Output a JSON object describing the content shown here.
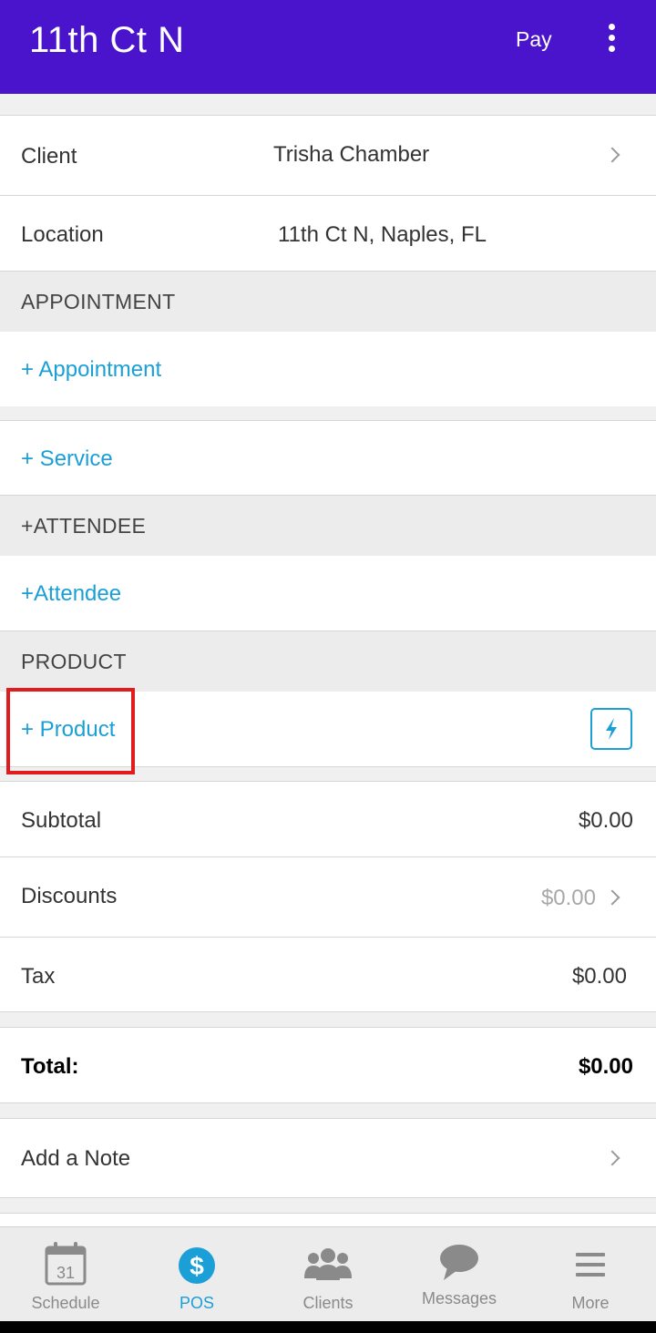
{
  "header": {
    "title": "11th Ct N",
    "pay_label": "Pay",
    "menu_icon": "more-vert-icon",
    "bg_color": "#4a14cc"
  },
  "client": {
    "label": "Client",
    "value": "Trisha Chamber"
  },
  "location": {
    "label": "Location",
    "value": "11th Ct N, Naples, FL"
  },
  "appointment": {
    "header": "APPOINTMENT",
    "add_label": "+ Appointment"
  },
  "service": {
    "add_label": "+ Service"
  },
  "attendee": {
    "header": "+ATTENDEE",
    "add_label": "+Attendee"
  },
  "product": {
    "header": "PRODUCT",
    "add_label": "+ Product",
    "quick_icon": "lightning-icon"
  },
  "totals": {
    "subtotal_label": "Subtotal",
    "subtotal_value": "$0.00",
    "discounts_label": "Discounts",
    "discounts_value": "$0.00",
    "tax_label": "Tax",
    "tax_value": "$0.00",
    "total_label": "Total:",
    "total_value": "$0.00"
  },
  "note": {
    "label": "Add a Note"
  },
  "tabs": [
    {
      "label": "Schedule",
      "icon": "calendar-icon",
      "active": false,
      "icon_text": "31"
    },
    {
      "label": "POS",
      "icon": "dollar-icon",
      "active": true
    },
    {
      "label": "Clients",
      "icon": "people-icon",
      "active": false
    },
    {
      "label": "Messages",
      "icon": "chat-bubble-icon",
      "active": false
    },
    {
      "label": "More",
      "icon": "hamburger-icon",
      "active": false
    }
  ],
  "colors": {
    "accent": "#1a9fd6",
    "highlight": "#e01c1c"
  }
}
